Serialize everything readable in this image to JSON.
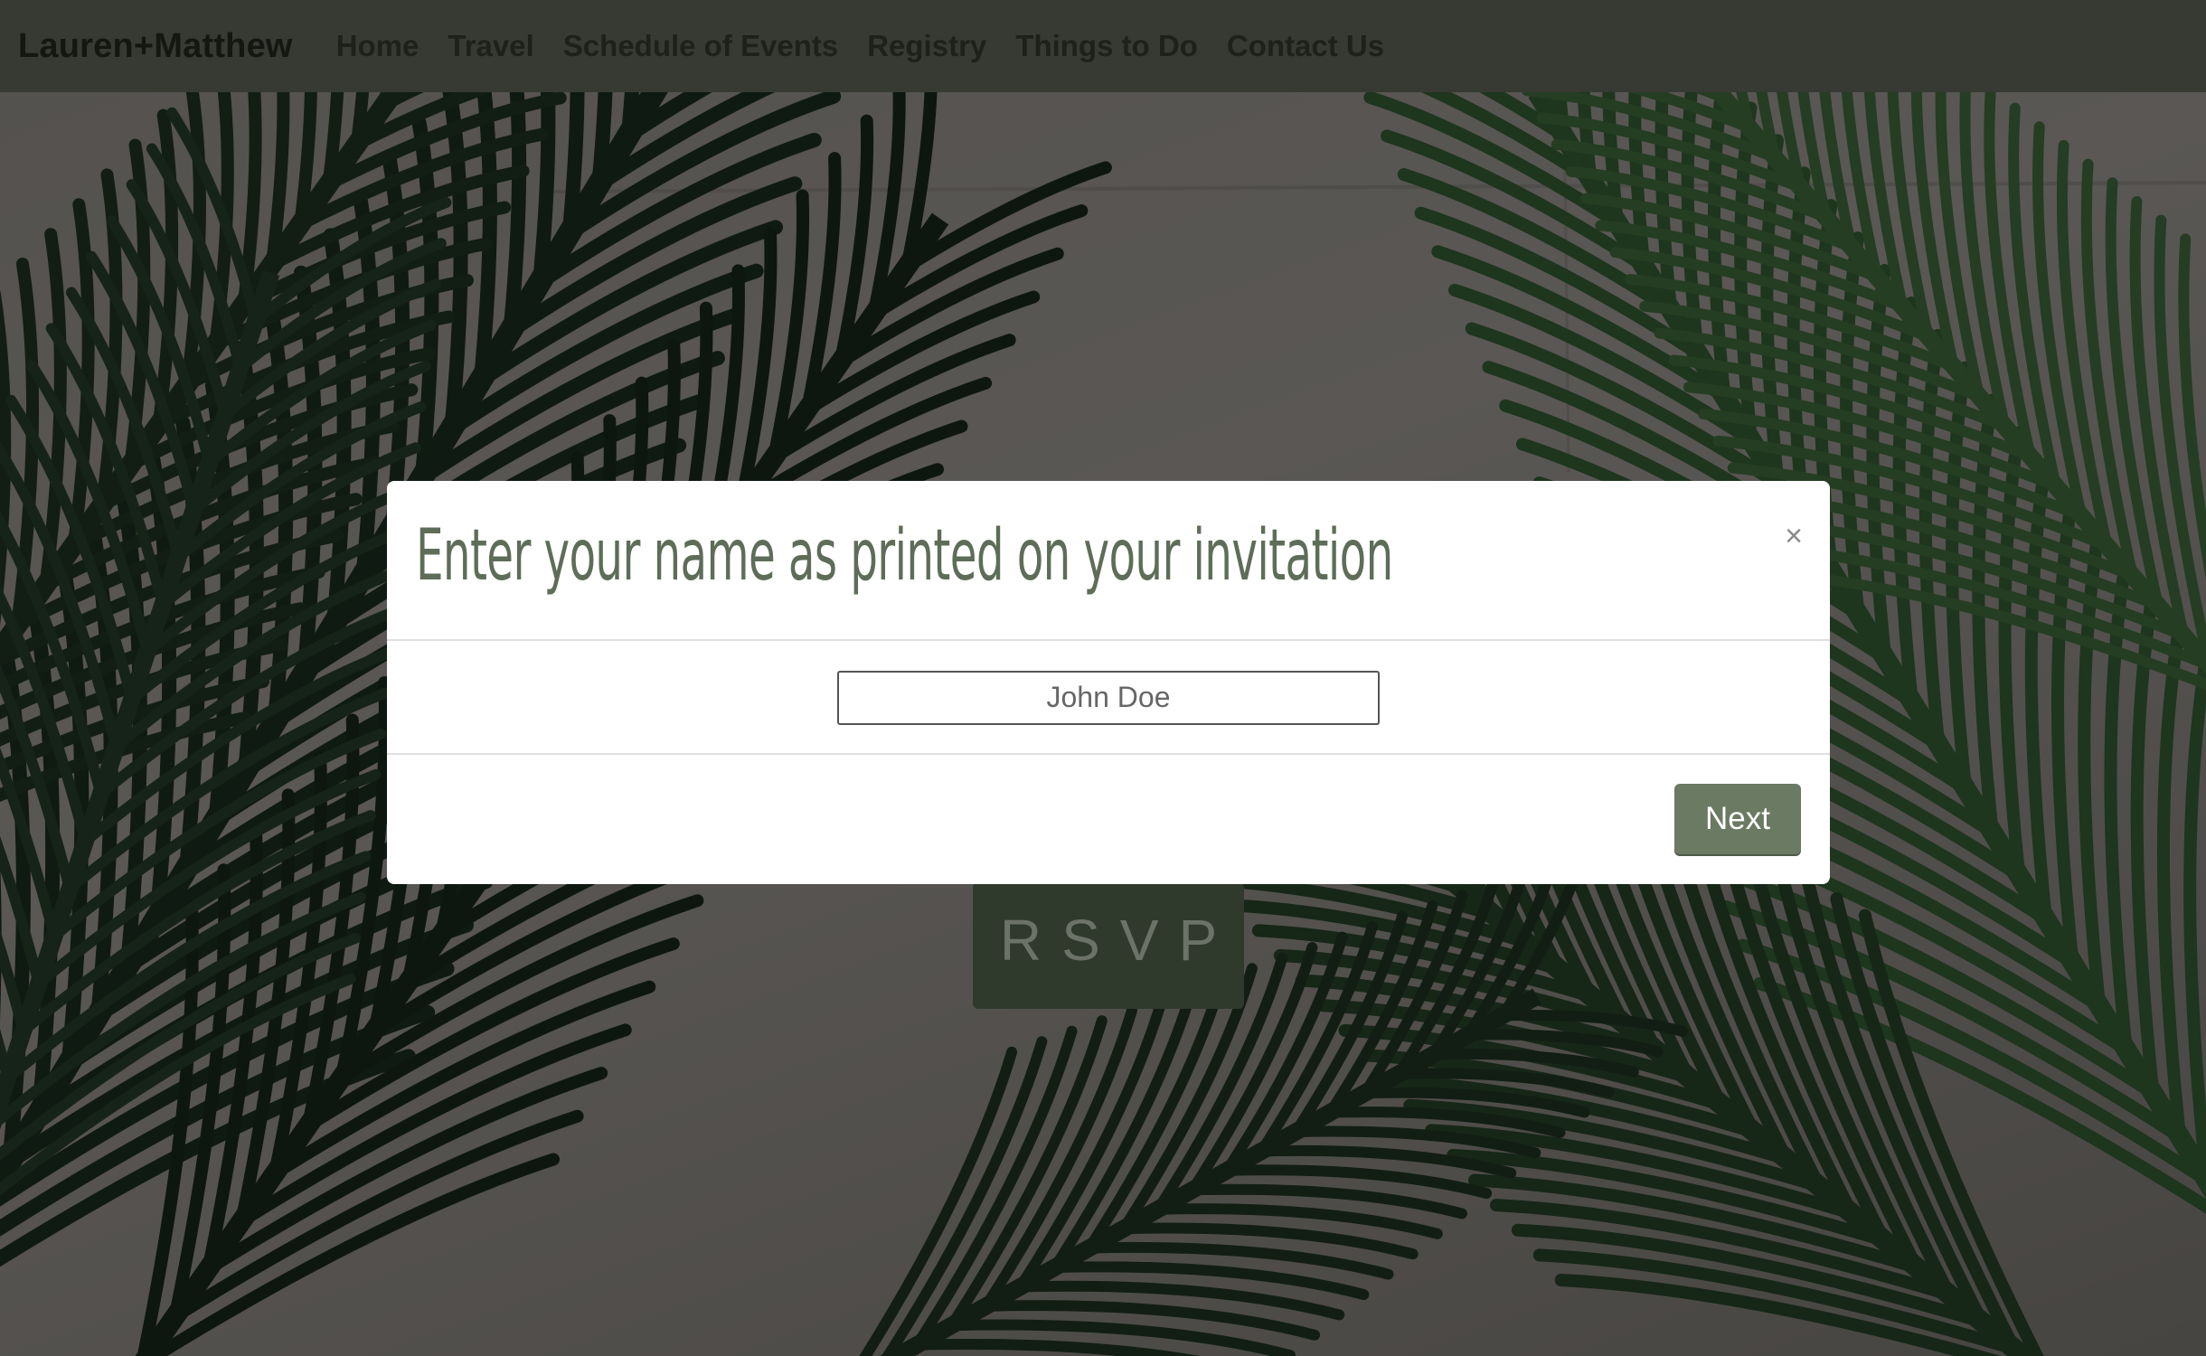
{
  "navbar": {
    "brand": "Lauren+Matthew",
    "links": [
      "Home",
      "Travel",
      "Schedule of Events",
      "Registry",
      "Things to Do",
      "Contact Us"
    ]
  },
  "rsvp_label": "RSVP",
  "modal": {
    "title": "Enter your name as printed on your invitation",
    "close_label": "×",
    "input_placeholder": "John Doe",
    "input_value": "",
    "next_label": "Next"
  },
  "colors": {
    "navbar_bg": "#363a33",
    "accent_green": "#6b7a63",
    "title_green": "#5e6d58",
    "rsvp_bg": "#2f3a2d"
  }
}
